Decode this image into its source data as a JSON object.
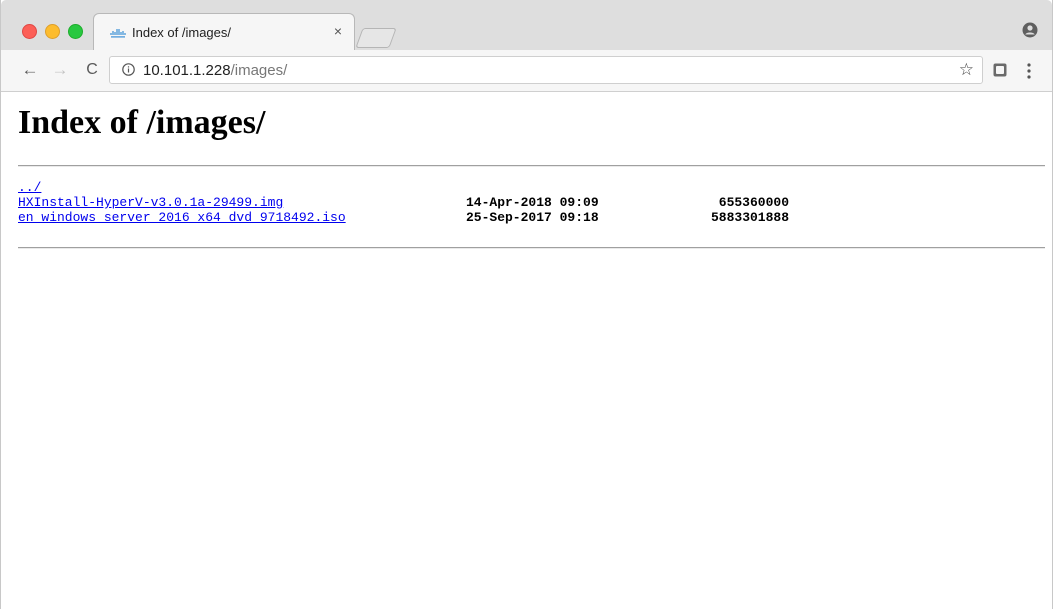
{
  "browser": {
    "tab": {
      "title": "Index of /images/",
      "close": "×"
    },
    "nav": {
      "back": "←",
      "forward": "→",
      "reload": "C"
    },
    "address": {
      "host": "10.101.1.228",
      "path": "/images/"
    },
    "icons": {
      "favicon": "cisco-favicon-icon",
      "profile": "profile-icon",
      "info": "info-icon",
      "bookmark": "star-icon",
      "extension": "extension-icon",
      "menu": "menu-icon"
    },
    "bookmark_glyph": "☆"
  },
  "page": {
    "title": "Index of /images/",
    "entries": [
      {
        "name": "../",
        "date": "",
        "size": ""
      },
      {
        "name": "HXInstall-HyperV-v3.0.1a-29499.img",
        "date": "14-Apr-2018 09:09",
        "size": "655360000"
      },
      {
        "name": "en_windows_server_2016_x64_dvd_9718492.iso",
        "date": "25-Sep-2017 09:18",
        "size": "5883301888"
      }
    ]
  }
}
